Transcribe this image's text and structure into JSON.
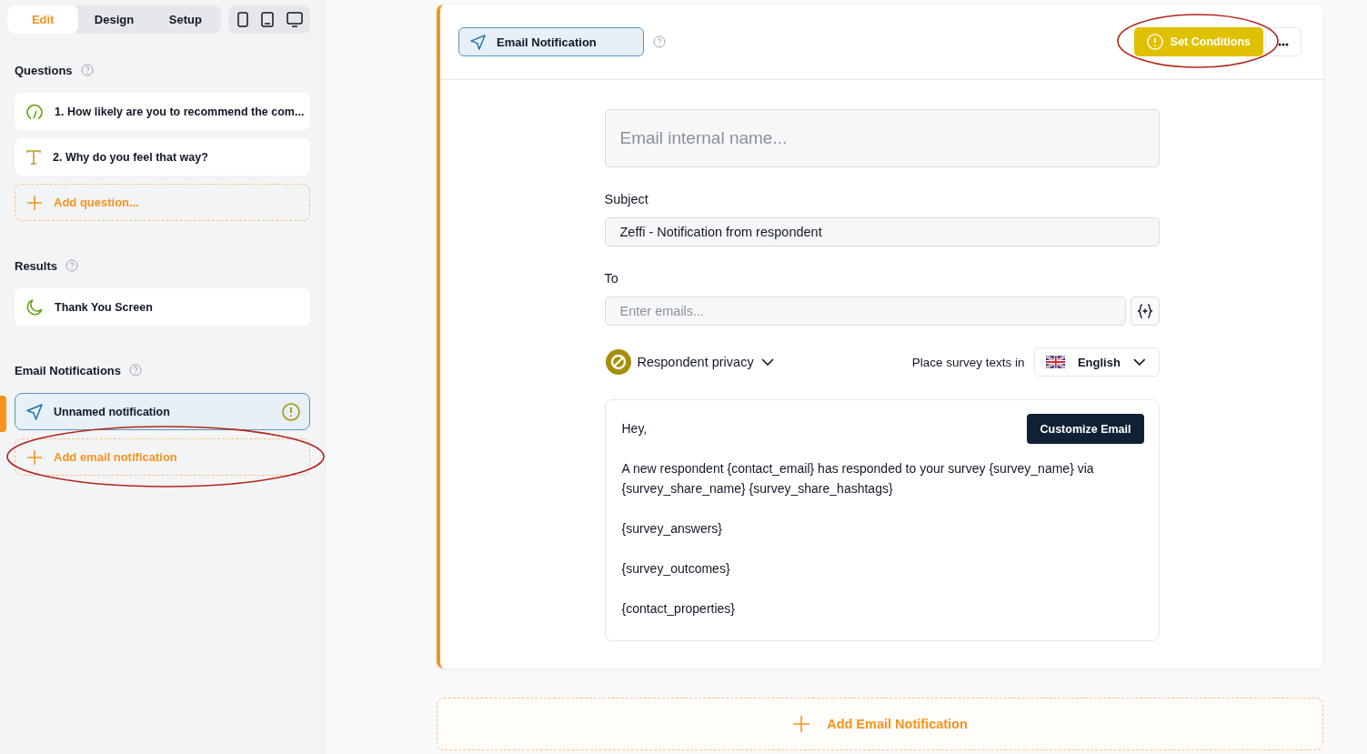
{
  "tabs": [
    {
      "label": "Edit",
      "selected": true
    },
    {
      "label": "Design",
      "selected": false
    },
    {
      "label": "Setup",
      "selected": false
    }
  ],
  "device_buttons": [
    {
      "kind": "phone"
    },
    {
      "kind": "tablet"
    },
    {
      "kind": "desktop"
    }
  ],
  "sections": [
    {
      "title": "Questions",
      "items": [
        {
          "kind": "rating",
          "label": "1. How likely are you to recommend the com...",
          "selected": false,
          "warning": false
        },
        {
          "kind": "text",
          "label": "2. Why do you feel that way?",
          "selected": false,
          "warning": false
        }
      ],
      "add_label": "Add question..."
    },
    {
      "title": "Results",
      "items": [
        {
          "kind": "ending",
          "label": "Thank You Screen",
          "selected": false,
          "warning": false
        }
      ]
    },
    {
      "title": "Email Notifications",
      "items": [
        {
          "kind": "notification",
          "label": "Unnamed notification",
          "selected": true,
          "warning": true
        }
      ],
      "add_label": "Add email notification"
    }
  ],
  "editor": {
    "title": "Email Notification",
    "conditions_button": "Set Conditions",
    "name_placeholder": "Email internal name...",
    "subject_label": "Subject",
    "subject_value": "Zeffi - Notification from respondent",
    "to_label": "To",
    "to_placeholder": "Enter emails...",
    "privacy_label": "Respondent privacy",
    "language_label": "Place survey texts in",
    "language": "English",
    "body": {
      "button": "Customize Email",
      "paragraphs": [
        "Hey,",
        "A new respondent {contact_email} has responded to your survey {survey_name} via {survey_share_name} {survey_share_hashtags}",
        "{survey_answers}",
        "{survey_outcomes}",
        "{contact_properties}"
      ]
    }
  },
  "add_notification_button": "Add Email Notification"
}
